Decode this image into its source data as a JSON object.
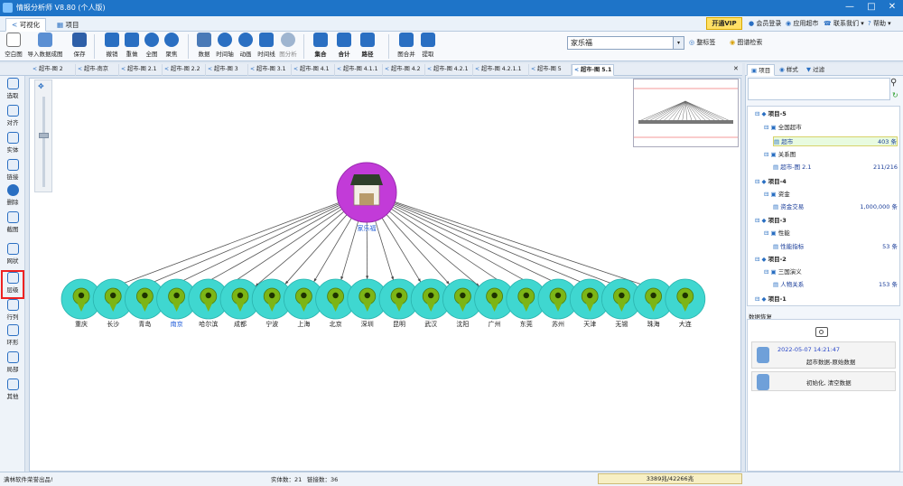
{
  "window": {
    "title": "情报分析师 V8.80 (个人版)",
    "controls": [
      "—",
      "□",
      "✕"
    ]
  },
  "ribbon_tabs": [
    "可视化",
    "项目"
  ],
  "topbar": {
    "vip": "开通VIP",
    "items": [
      "会员登录",
      "应用超市",
      "联系我们 ▾",
      "帮助 ▾"
    ]
  },
  "toolbar": {
    "buttons": [
      "空白图",
      "导入数据成图",
      "保存",
      "撤销",
      "重做",
      "全图",
      "聚焦",
      "数据",
      "时间轴",
      "动画",
      "时间线",
      "图分析",
      "集合",
      "合计",
      "路径",
      "图合并",
      "提取"
    ],
    "search_value": "家乐福",
    "combo_arrow": "▾",
    "extra": [
      "整标签",
      "图谱检索"
    ]
  },
  "doc_tabs": [
    "超市-图 2",
    "超市-南京",
    "超市-图 2.1",
    "超市-图 2.2",
    "超市-图 3",
    "超市-图 3.1",
    "超市-图 4.1",
    "超市-图 4.1.1",
    "超市-图 4.2",
    "超市-图 4.2.1",
    "超市-图 4.2.1.1",
    "超市-图 5",
    "超市-图 5.1"
  ],
  "active_doc_tab": 12,
  "left_tools": [
    "选取",
    "对齐",
    "实体",
    "链接",
    "删除",
    "截图",
    "网状",
    "层级",
    "行列",
    "环形",
    "局部",
    "其他"
  ],
  "selected_left_tool": 7,
  "graph": {
    "center_label": "家乐福",
    "nodes": [
      "重庆",
      "长沙",
      "青岛",
      "南京",
      "哈尔滨",
      "成都",
      "宁波",
      "上海",
      "北京",
      "深圳",
      "昆明",
      "武汉",
      "沈阳",
      "广州",
      "东莞",
      "苏州",
      "天津",
      "无锡",
      "珠海",
      "大连"
    ],
    "highlight_node": "南京",
    "colors": {
      "center_bg": "#c23bd8",
      "node_bg": "#3fd7d0",
      "pin": "#7cb516",
      "label_blue": "#1e5bd8"
    }
  },
  "right_panel": {
    "tabs": [
      "项目",
      "样式",
      "过滤"
    ],
    "search_icon": "⚲",
    "tree": [
      {
        "label": "项目-5",
        "level": 0
      },
      {
        "label": "全国超市",
        "level": 1
      },
      {
        "label": "超市",
        "level": 2,
        "count": "403 条",
        "highlight": true
      },
      {
        "label": "关系图",
        "level": 1
      },
      {
        "label": "超市-图 2.1",
        "level": 2,
        "count": "211/216",
        "red": false
      },
      {
        "label": "项目-4",
        "level": 0
      },
      {
        "label": "资金",
        "level": 1
      },
      {
        "label": "资金交易",
        "level": 2,
        "count": "1,000,000 条"
      },
      {
        "label": "项目-3",
        "level": 0
      },
      {
        "label": "性能",
        "level": 1
      },
      {
        "label": "性能指标",
        "level": 2,
        "count": "53 条"
      },
      {
        "label": "项目-2",
        "level": 0
      },
      {
        "label": "三国演义",
        "level": 1
      },
      {
        "label": "人物关系",
        "level": 2,
        "count": "153 条"
      },
      {
        "label": "项目-1",
        "level": 0
      }
    ],
    "data_title": "数据恢复",
    "camera_icon": "camera",
    "cards": [
      {
        "time": "2022-05-07 14:21:47",
        "text": "超市数据-原始数据"
      },
      {
        "text": "初始化, 清空数据"
      }
    ]
  },
  "statusbar": {
    "left": "满林软件荣誉出品!",
    "entities": "实体数：21",
    "links": "链接数：36",
    "memory": "3389兆/42266兆"
  }
}
